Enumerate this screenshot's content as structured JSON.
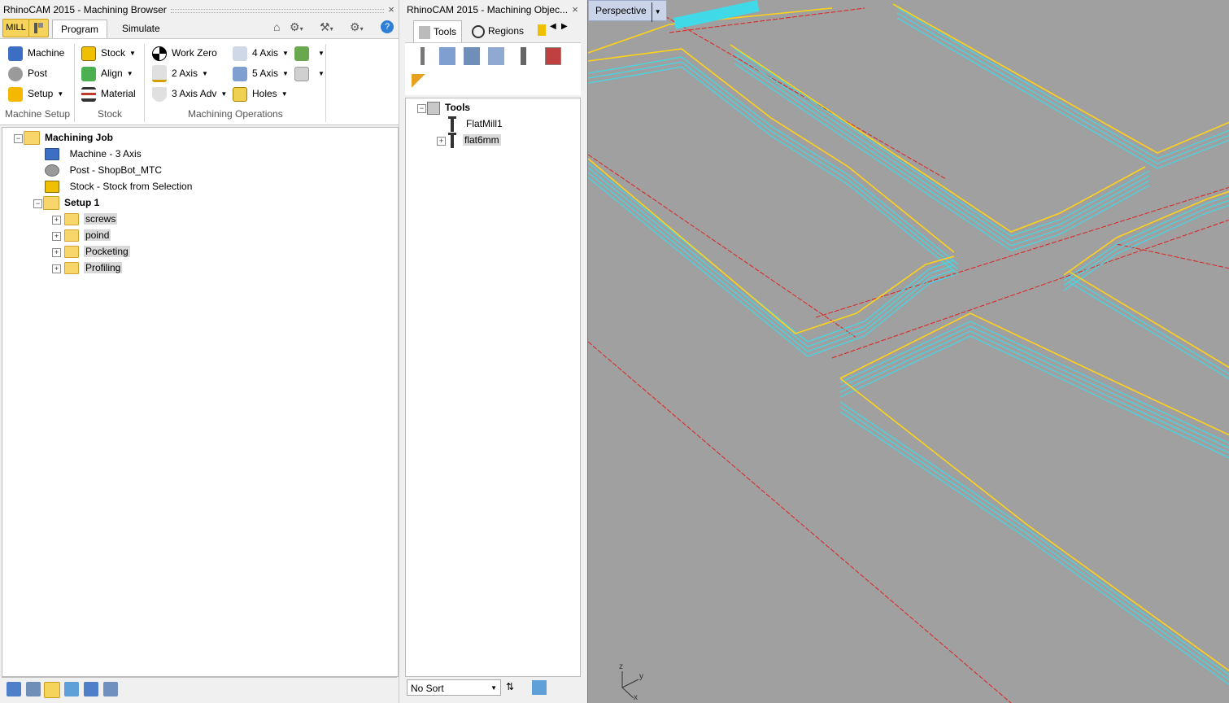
{
  "browser": {
    "title": "RhinoCAM 2015 - Machining Browser",
    "close": "×",
    "mill_label": "MILL",
    "tabs": {
      "program": "Program",
      "simulate": "Simulate"
    },
    "machine_setup": {
      "machine": "Machine",
      "post": "Post",
      "setup": "Setup",
      "group": "Machine Setup"
    },
    "stock": {
      "stock": "Stock",
      "align": "Align",
      "material": "Material",
      "group": "Stock"
    },
    "ops": {
      "work_zero": "Work Zero",
      "axis2": "2 Axis",
      "axis3_adv": "3 Axis Adv",
      "axis4": "4 Axis",
      "axis5": "5 Axis",
      "holes": "Holes",
      "group": "Machining Operations"
    },
    "tree": {
      "job": "Machining Job",
      "machine": "Machine - 3 Axis",
      "post": "Post - ShopBot_MTC",
      "stock": "Stock - Stock from Selection",
      "setup": "Setup 1",
      "folders": [
        "screws",
        "poind",
        "Pocketing",
        "Profiling"
      ]
    }
  },
  "objects": {
    "title": "RhinoCAM 2015 - Machining Objec...",
    "close": "×",
    "tabs": {
      "tools": "Tools",
      "regions": "Regions"
    },
    "tree": {
      "root": "Tools",
      "items": [
        "FlatMill1",
        "flat6mm"
      ]
    },
    "sort": "No Sort"
  },
  "viewport": {
    "label": "Perspective",
    "axes": {
      "z": "z",
      "y": "y",
      "x": "x"
    }
  },
  "colors": {
    "toolpath": "#3fd9e8",
    "edge": "#ffd21a",
    "rapid": "#e02020",
    "viewport_bg": "#a0a0a0",
    "accent": "#f6d35a"
  }
}
